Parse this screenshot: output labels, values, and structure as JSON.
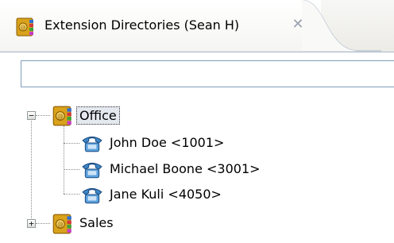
{
  "tab": {
    "title": "Extension Directories (Sean H)",
    "close_glyph": "✕"
  },
  "search": {
    "value": "",
    "placeholder": ""
  },
  "tree": {
    "groups": [
      {
        "label": "Office",
        "expanded": true,
        "expander_glyph": "−",
        "contacts": [
          {
            "label": "John Doe <1001>"
          },
          {
            "label": "Michael Boone <3001>"
          },
          {
            "label": "Jane Kuli <4050>"
          }
        ]
      },
      {
        "label": "Sales",
        "expanded": false,
        "expander_glyph": "+"
      }
    ]
  },
  "icons": {
    "directory": "address-book-icon",
    "contact": "telephone-icon"
  },
  "colors": {
    "border": "#7f9db9",
    "selection_bg": "#e4e8ef",
    "phone_icon": "#3d86c6"
  }
}
